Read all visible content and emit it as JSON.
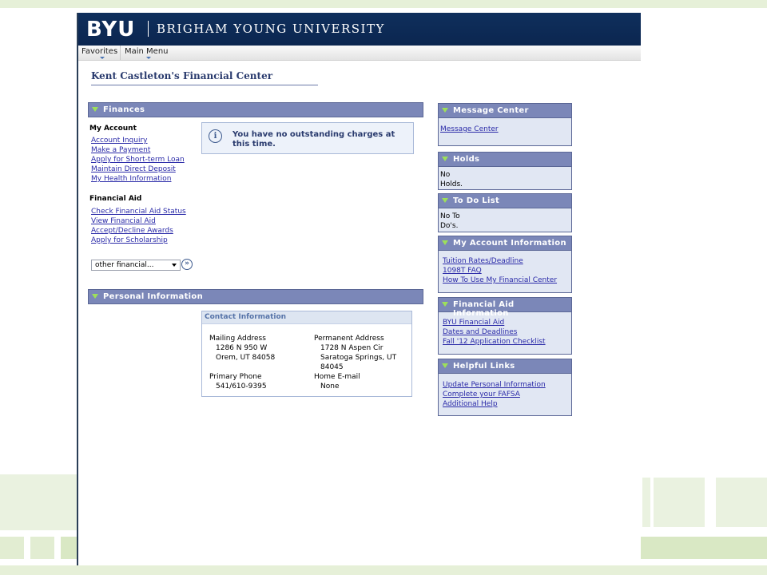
{
  "banner": {
    "logo": "BYU",
    "university": "BRIGHAM YOUNG UNIVERSITY"
  },
  "menu": {
    "items": [
      "Favorites",
      "Main Menu"
    ]
  },
  "page_title": "Kent Castleton's Financial Center",
  "finances": {
    "title": "Finances",
    "my_account": {
      "heading": "My Account",
      "links": [
        "Account Inquiry",
        "Make a Payment",
        "Apply for Short-term Loan",
        "Maintain Direct Deposit",
        "My Health Information"
      ]
    },
    "financial_aid": {
      "heading": "Financial Aid",
      "links": [
        "Check Financial Aid Status",
        "View Financial Aid",
        "Accept/Decline Awards",
        "Apply for Scholarship"
      ]
    },
    "notice": "You have no outstanding charges at this time.",
    "select_value": "other financial..."
  },
  "personal": {
    "title": "Personal Information",
    "contact_title": "Contact Information",
    "mailing_label": "Mailing Address",
    "mailing_line1": "1286 N 950 W",
    "mailing_line2": "Orem, UT 84058",
    "permanent_label": "Permanent Address",
    "permanent_line1": "1728 N Aspen Cir",
    "permanent_line2": "Saratoga Springs, UT",
    "permanent_line3": "84045",
    "phone_label": "Primary Phone",
    "phone_value": "541/610-9395",
    "email_label": "Home E-mail",
    "email_value": "None"
  },
  "sidebar": {
    "message_center": {
      "title": "Message Center",
      "link": "Message Center"
    },
    "holds": {
      "title": "Holds",
      "line1": "No",
      "line2": "Holds."
    },
    "todo": {
      "title": "To Do List",
      "line1": "No To",
      "line2": "Do's."
    },
    "account_info": {
      "title": "My Account Information",
      "links": [
        "Tuition Rates/Deadline",
        "1098T FAQ",
        "How To Use My Financial Center"
      ]
    },
    "aid_info": {
      "title": "Financial Aid Information",
      "links": [
        "BYU Financial Aid",
        "Dates and Deadlines",
        "Fall '12 Application Checklist"
      ]
    },
    "helpful": {
      "title": "Helpful Links",
      "links": [
        "Update Personal Information",
        "Complete your FAFSA",
        "Additional Help"
      ]
    }
  },
  "colors": {
    "banner": "#0f2f5c",
    "panel_header": "#7b87b8",
    "link": "#2a2aa8",
    "side_box": "#e1e7f3",
    "accent_triangle": "#9de05a"
  }
}
